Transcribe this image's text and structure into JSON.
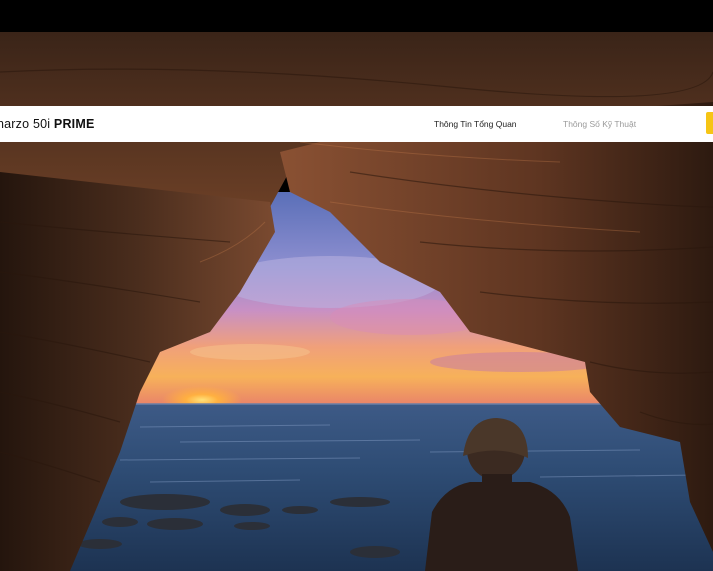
{
  "navbar": {
    "brand": {
      "model": "narzo 50i",
      "variant": "PRIME"
    },
    "links": [
      {
        "label": "Thông Tin Tổng Quan",
        "active": true
      },
      {
        "label": "Thông Số Kỹ Thuật",
        "active": false
      }
    ],
    "buy_button_color": "#f6c515"
  },
  "hero": {
    "scene": "sea-cave-sunset"
  },
  "colors": {
    "top_bar": "#000000",
    "navbar_bg": "#ffffff",
    "active_link": "#222222",
    "inactive_link": "#9a9a9a"
  }
}
